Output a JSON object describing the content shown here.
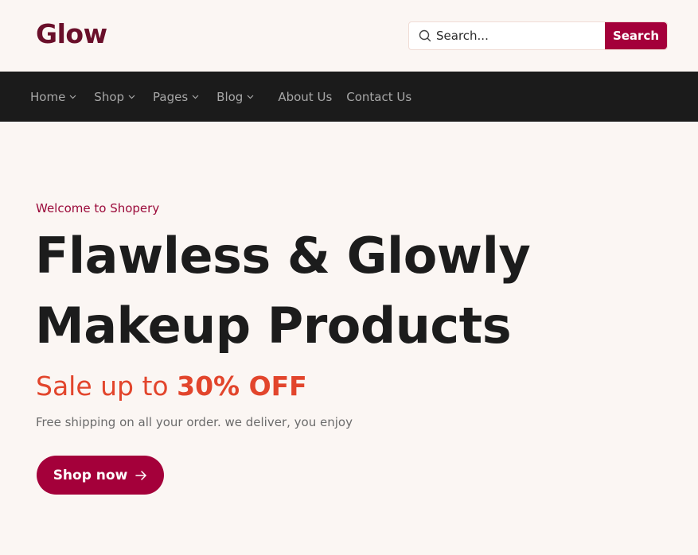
{
  "header": {
    "logo": "Glow",
    "search": {
      "placeholder": "Search...",
      "value": "",
      "button_label": "Search",
      "icon": "search-icon"
    }
  },
  "nav": {
    "items": [
      {
        "label": "Home",
        "has_dropdown": true
      },
      {
        "label": "Shop",
        "has_dropdown": true
      },
      {
        "label": "Pages",
        "has_dropdown": true
      },
      {
        "label": "Blog",
        "has_dropdown": true
      },
      {
        "label": "About Us",
        "has_dropdown": false
      },
      {
        "label": "Contact Us",
        "has_dropdown": false
      }
    ]
  },
  "hero": {
    "eyebrow": "Welcome to Shopery",
    "title_line1": "Flawless & Glowly",
    "title_line2": "Makeup Products",
    "sale_prefix": "Sale up to ",
    "sale_value": "30% OFF",
    "subtitle": "Free shipping on all your order. we deliver, you enjoy",
    "cta_label": "Shop now",
    "cta_icon": "arrow-right-icon"
  },
  "colors": {
    "brand": "#a4003a",
    "logo": "#6a0f2a",
    "accent_sale": "#e2452c",
    "nav_bg": "#1b1b1b",
    "page_bg": "#fbf6f3"
  }
}
